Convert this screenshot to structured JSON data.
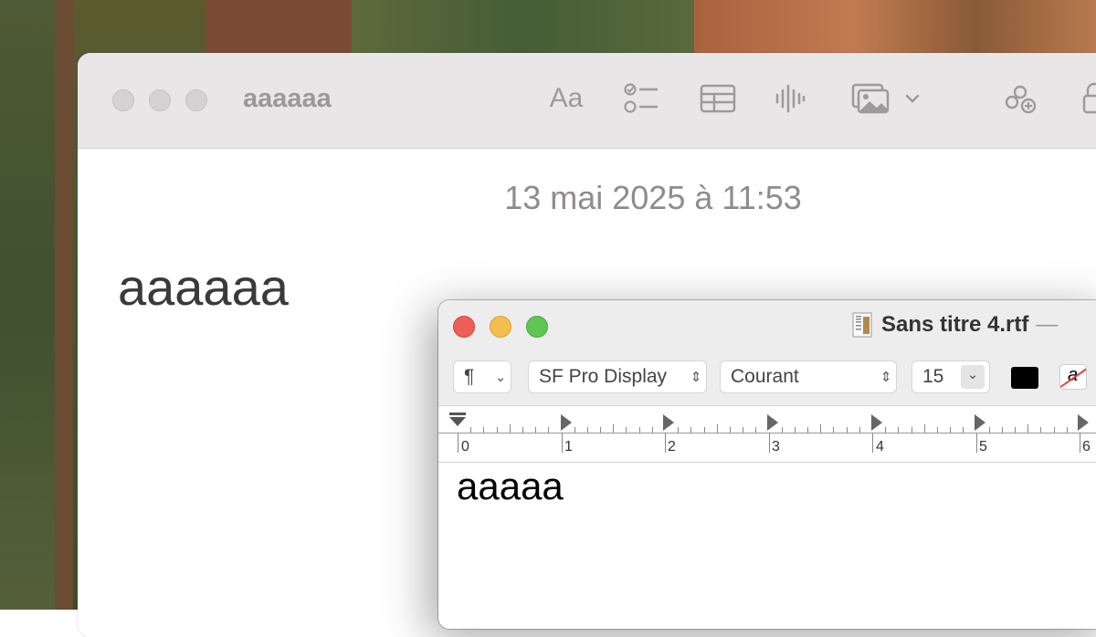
{
  "notes_window": {
    "title": "aaaaaa",
    "date": "13 mai 2025 à 11:53",
    "body": "aaaaaa",
    "toolbar": {
      "format_label": "Aa",
      "icons": [
        "checklist-icon",
        "table-icon",
        "audio-waveform-icon",
        "media-icon",
        "chevron-down-icon",
        "collaborate-icon",
        "lock-icon"
      ]
    }
  },
  "textedit_window": {
    "title": "Sans titre 4.rtf",
    "title_suffix": "—",
    "toolbar": {
      "paragraph_symbol": "¶",
      "font_family": "SF Pro Display",
      "font_style": "Courant",
      "font_size": "15",
      "text_color": "#000000",
      "highlight_glyph": "a"
    },
    "ruler": {
      "labels": [
        "0",
        "1",
        "2",
        "3",
        "4",
        "5",
        "6"
      ]
    },
    "body": "aaaaa"
  },
  "colors": {
    "traffic_close": "#ee5e57",
    "traffic_minimize": "#f5bd4f",
    "traffic_zoom": "#61c554",
    "inactive_light": "#d4d2d3"
  }
}
